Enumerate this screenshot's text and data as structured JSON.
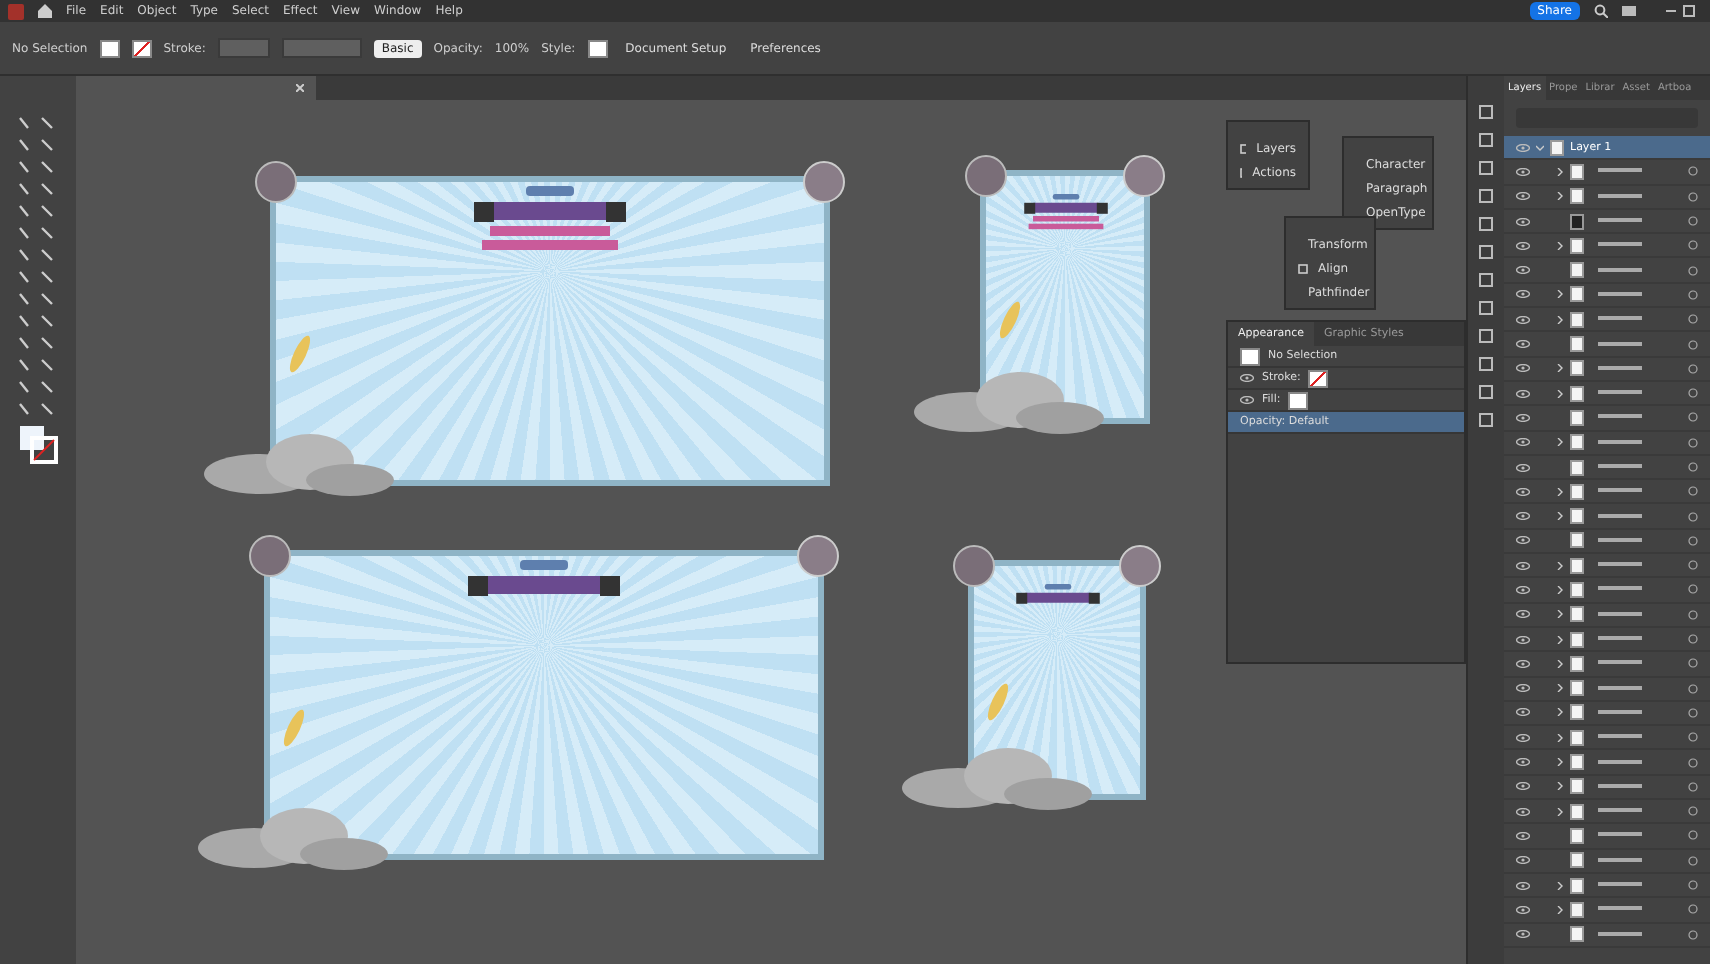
{
  "menu": [
    "File",
    "Edit",
    "Object",
    "Type",
    "Select",
    "Effect",
    "View",
    "Window",
    "Help"
  ],
  "share_button": "Share",
  "control_bar": {
    "selection": "No Selection",
    "stroke_label": "Stroke:",
    "brush": "Basic",
    "opacity_label": "Opacity:",
    "opacity": "100%",
    "style_label": "Style:",
    "document_setup": "Document Setup",
    "preferences": "Preferences"
  },
  "floating_panels": [
    {
      "items": [
        "Layers",
        "Actions"
      ]
    },
    {
      "items": [
        "Character",
        "Paragraph",
        "OpenType"
      ]
    },
    {
      "items": [
        "Transform",
        "Align",
        "Pathfinder"
      ]
    }
  ],
  "appearance_panel": {
    "tabs": [
      {
        "label": "Appearance",
        "selected": true
      },
      {
        "label": "Graphic Styles",
        "selected": false
      }
    ],
    "rows": [
      {
        "kind": "header",
        "label": "No Selection"
      },
      {
        "kind": "stroke",
        "label": "Stroke:"
      },
      {
        "kind": "fill",
        "label": "Fill:"
      },
      {
        "kind": "opacity",
        "label": "Opacity: Default",
        "selected": true
      }
    ]
  },
  "layers_panel": {
    "tabs": [
      {
        "label": "Layers",
        "selected": true
      },
      {
        "label": "Prope",
        "selected": false
      },
      {
        "label": "Librar",
        "selected": false
      },
      {
        "label": "Asset",
        "selected": false
      },
      {
        "label": "Artboa",
        "selected": false
      }
    ],
    "layer": {
      "name": "Layer 1",
      "expanded": true,
      "selected": true
    },
    "rows": [
      {
        "kind": "group"
      },
      {
        "kind": "group"
      },
      {
        "kind": "text"
      },
      {
        "kind": "group"
      },
      {
        "kind": "path"
      },
      {
        "kind": "group"
      },
      {
        "kind": "group"
      },
      {
        "kind": "path"
      },
      {
        "kind": "group"
      },
      {
        "kind": "group"
      },
      {
        "kind": "path"
      },
      {
        "kind": "group"
      },
      {
        "kind": "path"
      },
      {
        "kind": "group"
      },
      {
        "kind": "group"
      },
      {
        "kind": "path"
      },
      {
        "kind": "group"
      },
      {
        "kind": "group"
      },
      {
        "kind": "group"
      },
      {
        "kind": "group"
      },
      {
        "kind": "group"
      },
      {
        "kind": "group"
      },
      {
        "kind": "group"
      },
      {
        "kind": "group"
      },
      {
        "kind": "group"
      },
      {
        "kind": "group"
      },
      {
        "kind": "group"
      },
      {
        "kind": "path"
      },
      {
        "kind": "path"
      },
      {
        "kind": "group"
      },
      {
        "kind": "group"
      },
      {
        "kind": "path"
      }
    ]
  }
}
